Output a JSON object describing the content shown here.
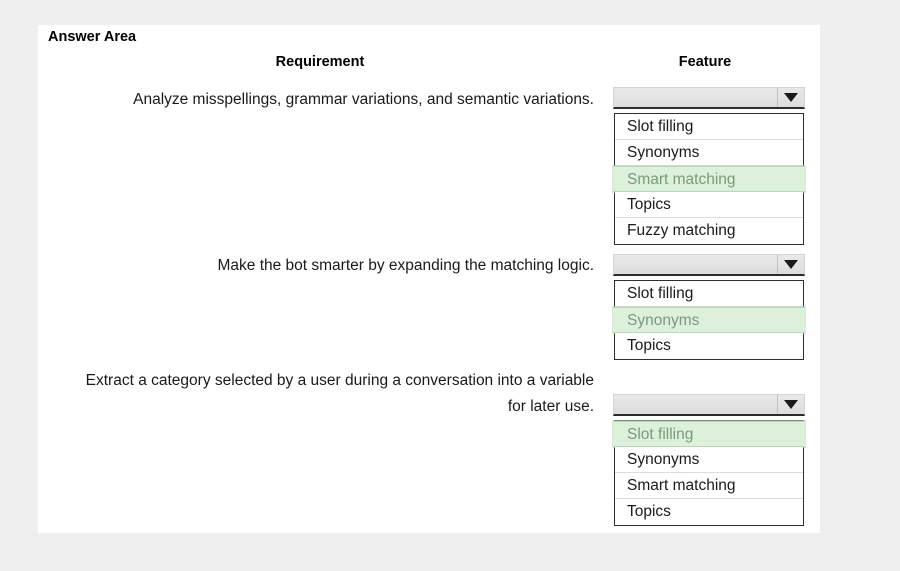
{
  "card": {
    "title": "Answer Area",
    "headers": {
      "requirement": "Requirement",
      "feature": "Feature"
    }
  },
  "colors": {
    "page_background": "#efefef",
    "card_background": "#ffffff",
    "selected_option_background": "#ddf0dc",
    "selected_option_text": "#7a9b7a",
    "dropdown_button_background": "#e3e3e3",
    "text": "#1a1a1a"
  },
  "rows": [
    {
      "requirement": "Analyze misspellings, grammar variations, and semantic variations.",
      "dropdown": {
        "icon": "chevron-down-icon",
        "selected": "Smart matching",
        "options": [
          "Slot filling",
          "Synonyms",
          "Smart matching",
          "Topics",
          "Fuzzy matching"
        ]
      }
    },
    {
      "requirement": "Make the bot smarter by expanding the matching logic.",
      "dropdown": {
        "icon": "chevron-down-icon",
        "selected": "Synonyms",
        "options": [
          "Slot filling",
          "Synonyms",
          "Topics"
        ]
      }
    },
    {
      "requirement": "Extract a category selected by a user during a conversation into a variable for later use.",
      "dropdown": {
        "icon": "chevron-down-icon",
        "selected": "Slot filling",
        "options": [
          "Slot filling",
          "Synonyms",
          "Smart matching",
          "Topics"
        ]
      }
    }
  ]
}
